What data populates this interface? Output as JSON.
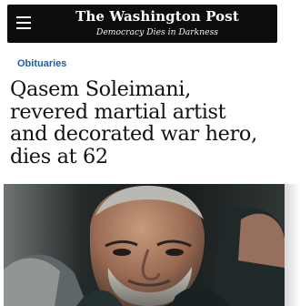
{
  "header": {
    "masthead": "The Washington Post",
    "tagline": "Democracy Dies in Darkness",
    "menu_icon": "hamburger-menu-icon"
  },
  "article": {
    "section_label": "Obituaries",
    "headline_lines": [
      "Qasem Soleimani,",
      "revered martial artist",
      "and decorated war hero,",
      "dies at 62"
    ],
    "image": "article-photo-image"
  },
  "colors": {
    "header_bg": "#0d0d0d",
    "section_link": "#1f5f9e",
    "headline_text": "#111111"
  }
}
